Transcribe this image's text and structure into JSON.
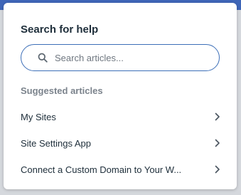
{
  "help_panel": {
    "title": "Search for help",
    "search": {
      "placeholder": "Search articles...",
      "value": ""
    },
    "suggested_label": "Suggested articles",
    "articles": [
      {
        "label": "My Sites"
      },
      {
        "label": "Site Settings App"
      },
      {
        "label": "Connect a Custom Domain to Your W..."
      }
    ]
  },
  "colors": {
    "accent": "#3d6fb8",
    "top_bar": "#3f66b8",
    "text": "#20303c",
    "muted": "#7b838c"
  },
  "icons": {
    "search": "search-icon",
    "chevron": "chevron-right-icon"
  }
}
